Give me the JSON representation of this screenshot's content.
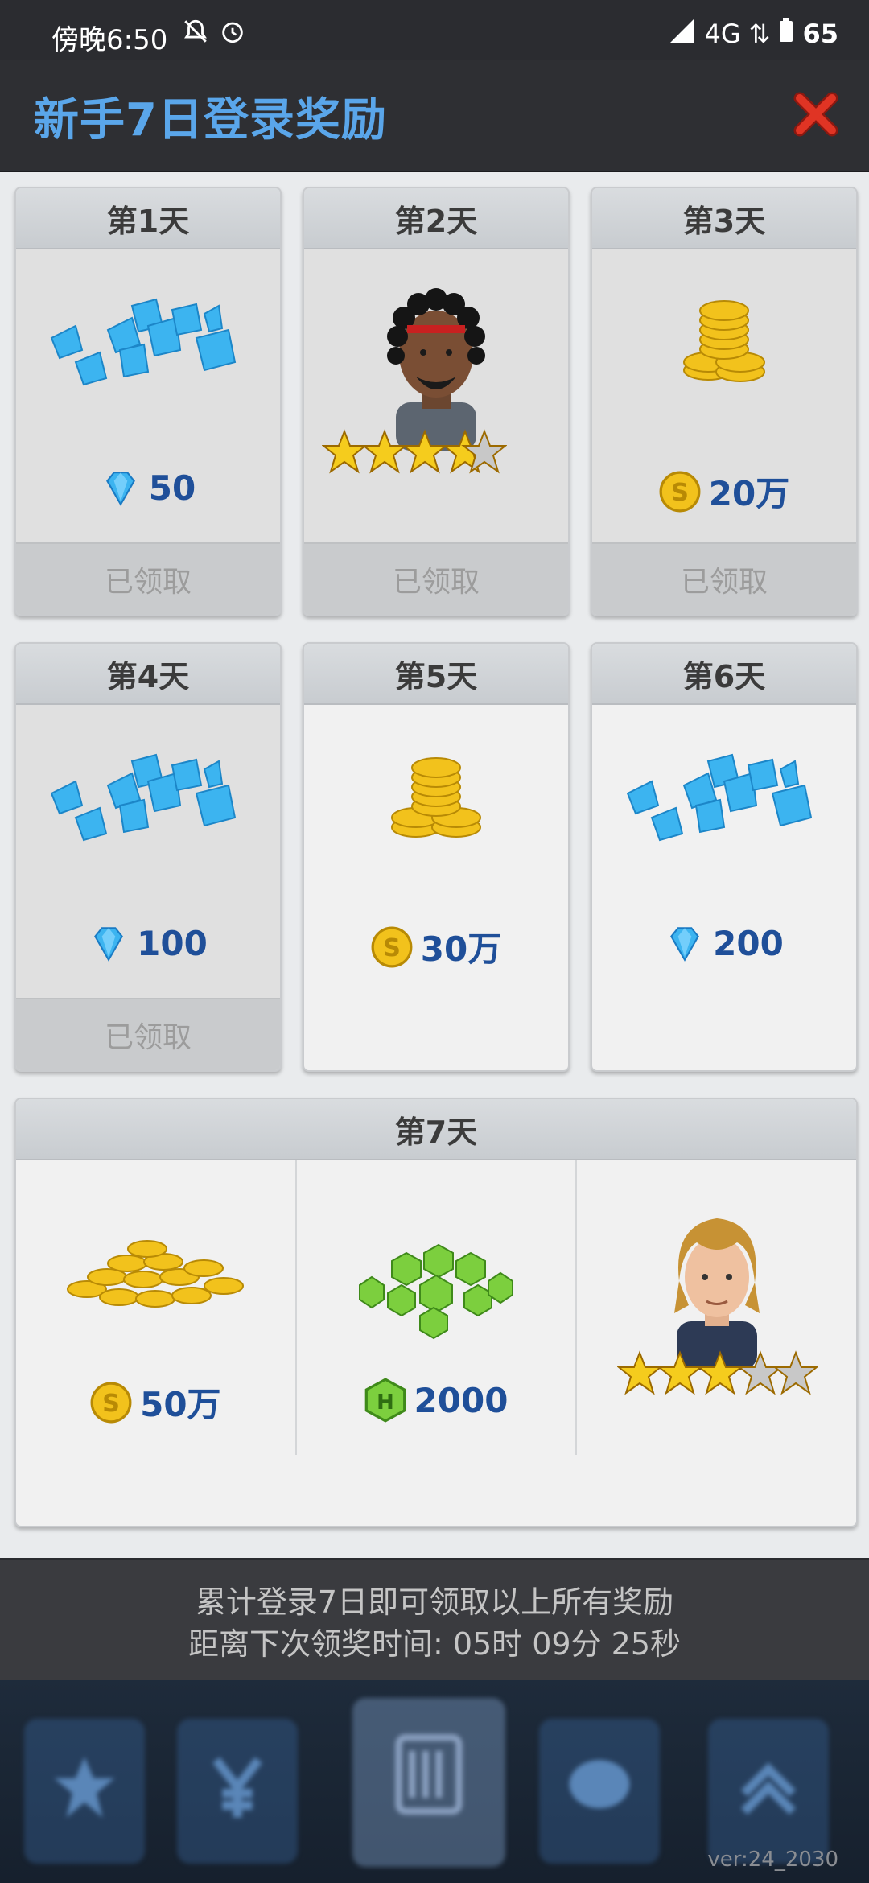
{
  "status_bar": {
    "time": "傍晚6:50",
    "network": "4G",
    "battery": "65"
  },
  "title_bar": {
    "title": "新手7日登录奖励"
  },
  "rewards": [
    {
      "day": "第1天",
      "amount": "50",
      "type": "diamond",
      "status": "已领取"
    },
    {
      "day": "第2天",
      "amount": "",
      "type": "player",
      "stars": 3.5,
      "status": "已领取"
    },
    {
      "day": "第3天",
      "amount": "20万",
      "type": "coin",
      "status": "已领取"
    },
    {
      "day": "第4天",
      "amount": "100",
      "type": "diamond",
      "status": "已领取"
    },
    {
      "day": "第5天",
      "amount": "30万",
      "type": "coin",
      "status": ""
    },
    {
      "day": "第6天",
      "amount": "200",
      "type": "diamond",
      "status": ""
    }
  ],
  "day7": {
    "day": "第7天",
    "items": [
      {
        "amount": "50万",
        "type": "coin"
      },
      {
        "amount": "2000",
        "type": "hex-token"
      },
      {
        "amount": "",
        "type": "player",
        "stars": 3
      }
    ]
  },
  "info": {
    "line1": "累计登录7日即可领取以上所有奖励",
    "line2": "距离下次领奖时间: 05时 09分 25秒"
  },
  "version": "ver:24_2030",
  "colors": {
    "title": "#5aa6ea",
    "amount": "#1f4f99",
    "close": "#d62a1e",
    "diamond": "#3cb4f0",
    "coin": "#f2c21c",
    "hex": "#7ccf3e"
  }
}
